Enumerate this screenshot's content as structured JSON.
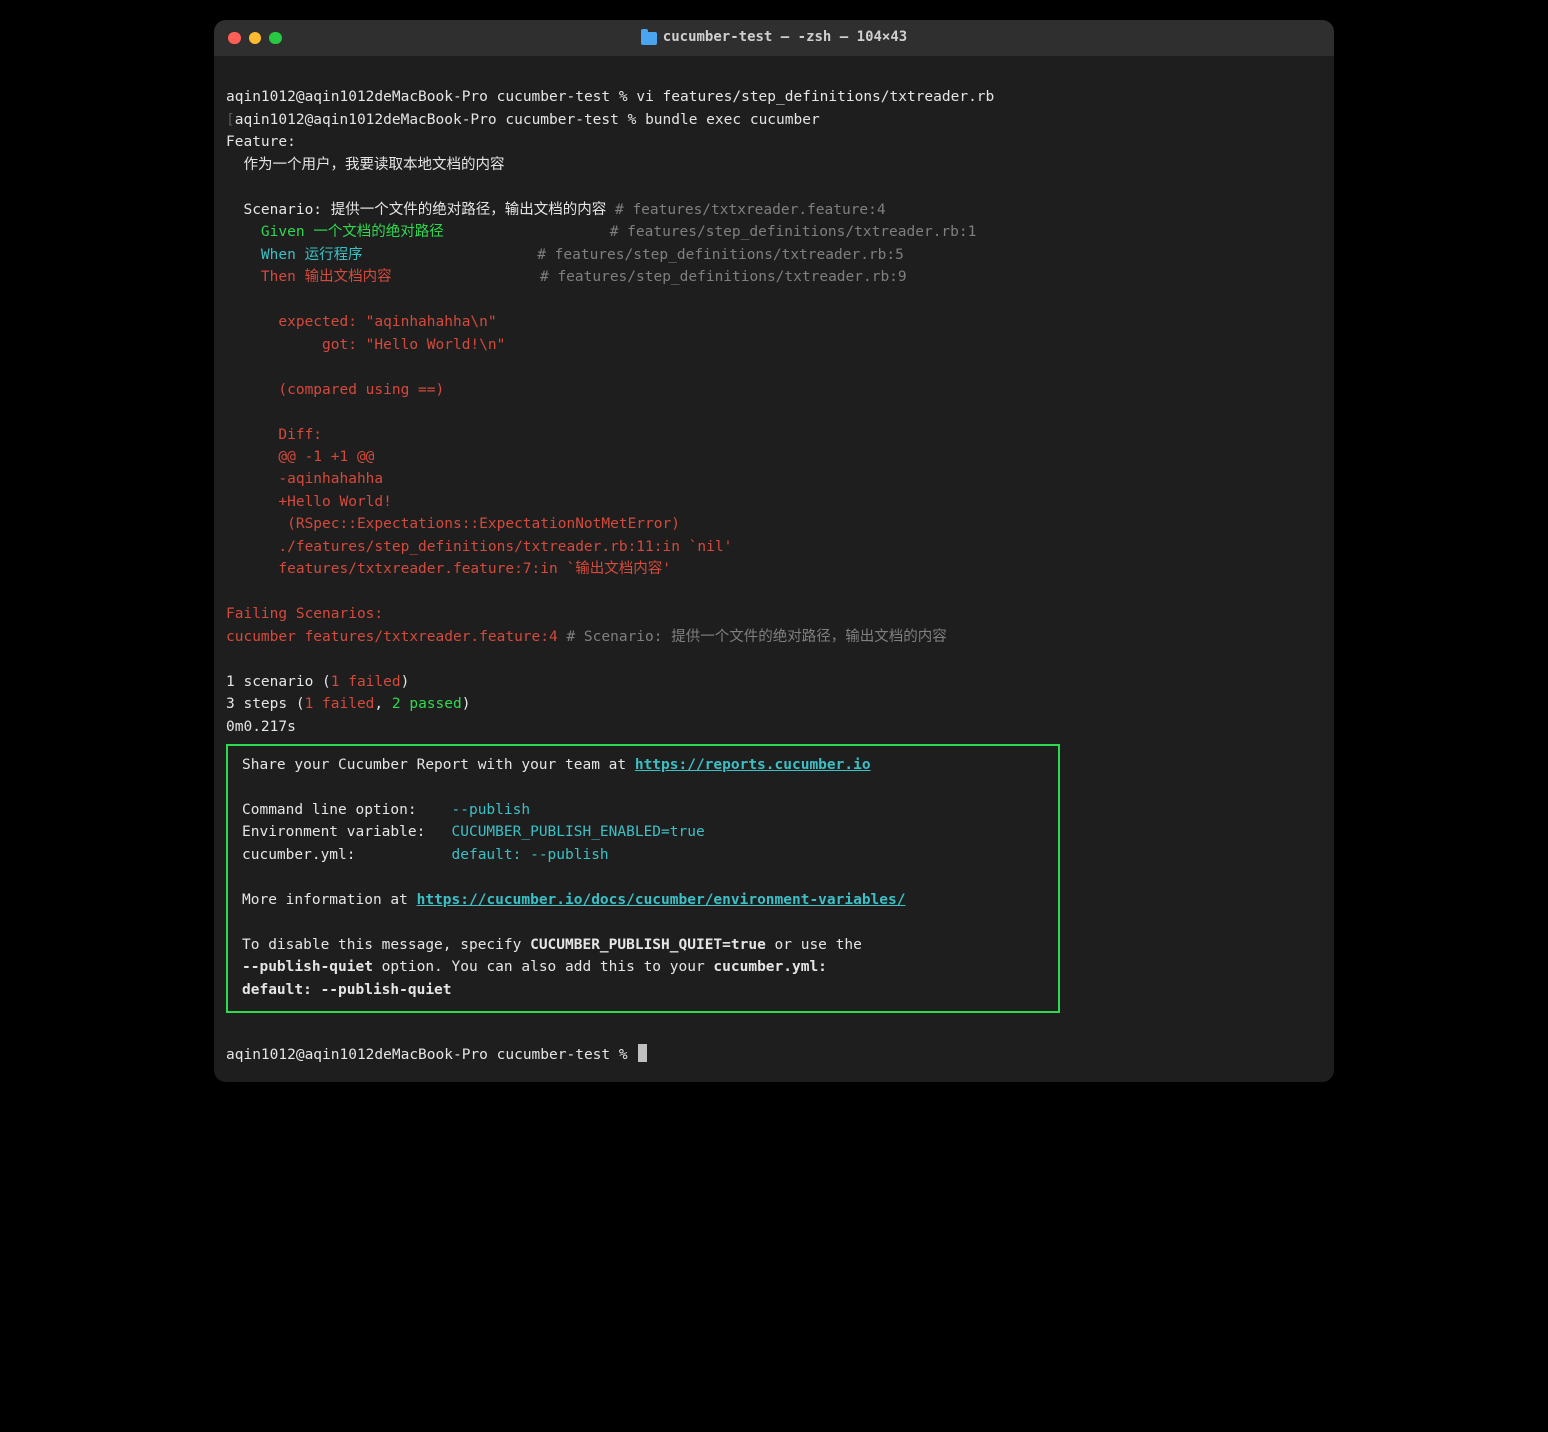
{
  "window": {
    "title": "cucumber-test — -zsh — 104×43"
  },
  "prompt": {
    "user_host": "aqin1012@aqin1012deMacBook-Pro",
    "dir": "cucumber-test",
    "sep": " % "
  },
  "cmd1": "vi features/step_definitions/txtreader.rb",
  "cmd2": "bundle exec cucumber",
  "feature_label": "Feature:",
  "feature_desc": "  作为一个用户，我要读取本地文档的内容",
  "scenario_pre": "  Scenario: ",
  "scenario_title": "提供一个文件的绝对路径，输出文档的内容",
  "scenario_comment": " # features/txtxreader.feature:4",
  "given": {
    "kw": "Given",
    "body": "一个文档的绝对路径",
    "comment": "# features/step_definitions/txtreader.rb:1"
  },
  "when": {
    "kw": "When",
    "body": "运行程序",
    "comment": "# features/step_definitions/txtreader.rb:5"
  },
  "then": {
    "kw": "Then",
    "body": "输出文档内容",
    "comment": "# features/step_definitions/txtreader.rb:9"
  },
  "diff": {
    "expected": "      expected: \"aqinhahahha\\n\"",
    "got": "           got: \"Hello World!\\n\"",
    "compared": "      (compared using ==)",
    "diff_label": "      Diff:",
    "hunk": "      @@ -1 +1 @@",
    "minus": "      -aqinhahahha",
    "plus": "      +Hello World!",
    "err": "       (RSpec::Expectations::ExpectationNotMetError)",
    "trace1": "      ./features/step_definitions/txtreader.rb:11:in `nil'",
    "trace2": "      features/txtxreader.feature:7:in `输出文档内容'"
  },
  "failing": {
    "header": "Failing Scenarios:",
    "line_red": "cucumber features/txtxreader.feature:4",
    "line_dim": " # Scenario: 提供一个文件的绝对路径，输出文档的内容"
  },
  "summary": {
    "s1_pre": "1 scenario (",
    "s1_fail": "1 failed",
    "s1_post": ")",
    "s2_pre": "3 steps (",
    "s2_fail": "1 failed",
    "s2_mid": ", ",
    "s2_pass": "2 passed",
    "s2_post": ")",
    "time": "0m0.217s"
  },
  "box": {
    "l1a": "Share your Cucumber Report with your team at ",
    "l1b": "https://reports.cucumber.io",
    "l2": "Command line option:    ",
    "l2v": "--publish",
    "l3": "Environment variable:   ",
    "l3v": "CUCUMBER_PUBLISH_ENABLED=true",
    "l4": "cucumber.yml:           ",
    "l4v": "default: --publish",
    "l5a": "More information at ",
    "l5b": "https://cucumber.io/docs/cucumber/environment-variables/",
    "l6a": "To disable this message, specify ",
    "l6b": "CUCUMBER_PUBLISH_QUIET=true",
    "l6c": " or use the",
    "l7a": "--publish-quiet",
    "l7b": " option. You can also add this to your ",
    "l7c": "cucumber.yml:",
    "l8": "default: --publish-quiet"
  }
}
